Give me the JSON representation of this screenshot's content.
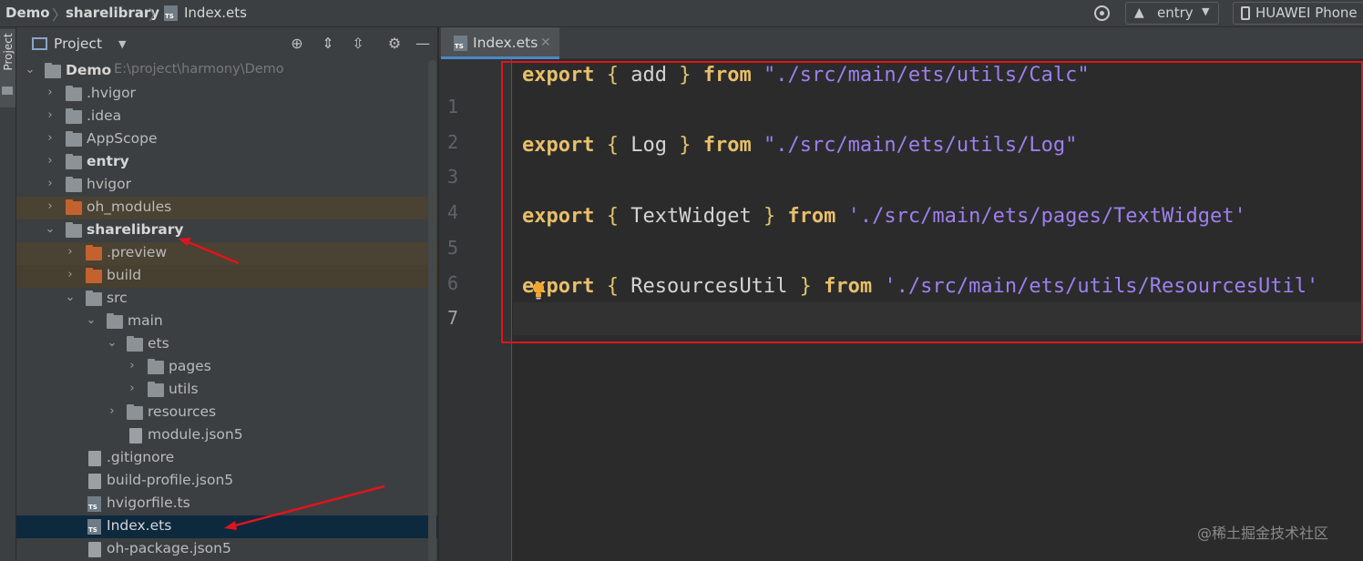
{
  "breadcrumb": {
    "project": "Demo",
    "module": "sharelibrary",
    "file": "Index.ets"
  },
  "toolbar": {
    "run_config": "entry",
    "device": "HUAWEI Phone"
  },
  "toolstrip": {
    "project_tab": "Project"
  },
  "project_panel": {
    "title": "Project",
    "tree": [
      {
        "label": "Demo",
        "path": "E:\\project\\harmony\\Demo",
        "bold": true
      },
      {
        "label": ".hvigor"
      },
      {
        "label": ".idea"
      },
      {
        "label": "AppScope"
      },
      {
        "label": "entry",
        "bold": true
      },
      {
        "label": "hvigor"
      },
      {
        "label": "oh_modules"
      },
      {
        "label": "sharelibrary",
        "bold": true
      },
      {
        "label": ".preview"
      },
      {
        "label": "build"
      },
      {
        "label": "src"
      },
      {
        "label": "main"
      },
      {
        "label": "ets"
      },
      {
        "label": "pages"
      },
      {
        "label": "utils"
      },
      {
        "label": "resources"
      },
      {
        "label": "module.json5"
      },
      {
        "label": ".gitignore"
      },
      {
        "label": "build-profile.json5"
      },
      {
        "label": "hvigorfile.ts"
      },
      {
        "label": "Index.ets"
      },
      {
        "label": "oh-package.json5"
      }
    ]
  },
  "editor": {
    "tab_label": "Index.ets",
    "line_numbers": [
      "1",
      "2",
      "3",
      "4",
      "5",
      "6",
      "7"
    ],
    "lines": [
      {
        "kw1": "export",
        "ob": "{",
        "name": "add",
        "cb": "}",
        "kw2": "from",
        "path": "\"./src/main/ets/utils/Calc\""
      },
      {
        "kw1": "export",
        "ob": "{",
        "name": "Log",
        "cb": "}",
        "kw2": "from",
        "path": "\"./src/main/ets/utils/Log\""
      },
      {
        "kw1": "export",
        "ob": "{",
        "name": "TextWidget",
        "cb": "}",
        "kw2": "from",
        "path": "'./src/main/ets/pages/TextWidget'"
      },
      {
        "kw1": "export",
        "ob": "{",
        "name": "ResourcesUtil",
        "cb": "}",
        "kw2": "from",
        "path": "'./src/main/ets/utils/ResourcesUtil'"
      }
    ]
  },
  "watermark": "@稀土掘金技术社区",
  "colors": {
    "highlight_box": "#e0141d",
    "annotation_arrow": "#e0141d",
    "string": "#9e7ff0",
    "keyword": "#cc7832"
  }
}
